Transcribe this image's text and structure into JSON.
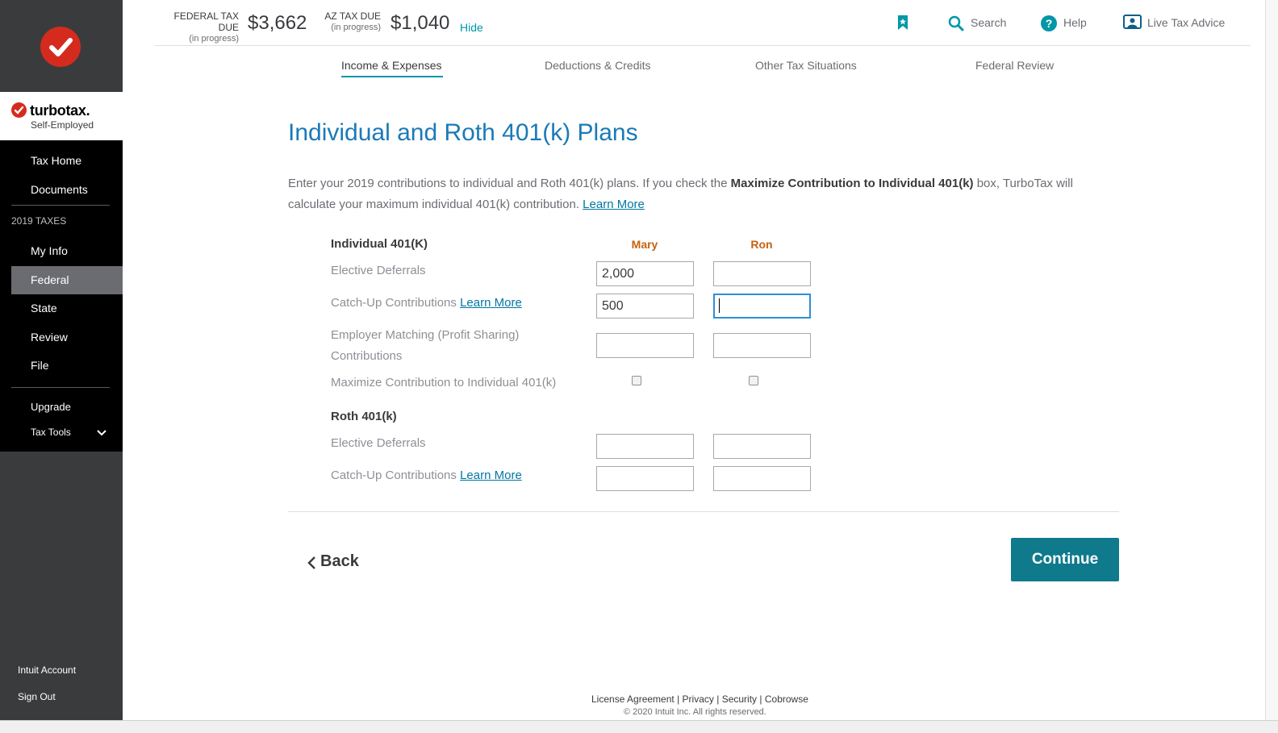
{
  "app": {
    "brand_name": "turbotax.",
    "brand_sub": "Self-Employed"
  },
  "sidebar": {
    "items": [
      {
        "label": "Tax Home"
      },
      {
        "label": "Documents"
      }
    ],
    "section_label": "2019 TAXES",
    "tax_items": [
      {
        "label": "My Info"
      },
      {
        "label": "Federal"
      },
      {
        "label": "State"
      },
      {
        "label": "Review"
      },
      {
        "label": "File"
      }
    ],
    "upgrade": "Upgrade",
    "tax_tools": "Tax Tools",
    "account": "Intuit Account",
    "sign_out": "Sign Out"
  },
  "header": {
    "federal_label": "FEDERAL TAX DUE",
    "federal_sub": "(in progress)",
    "federal_amount": "$3,662",
    "state_label": "AZ TAX DUE",
    "state_sub": "(in progress)",
    "state_amount": "$1,040",
    "hide": "Hide",
    "search": "Search",
    "help": "Help",
    "live_advice": "Live Tax Advice"
  },
  "tabs": [
    {
      "label": "Income & Expenses",
      "active": true
    },
    {
      "label": "Deductions & Credits"
    },
    {
      "label": "Other Tax Situations"
    },
    {
      "label": "Federal Review"
    }
  ],
  "main": {
    "title": "Individual and Roth 401(k) Plans",
    "intro_1": "Enter your 2019 contributions to individual and Roth 401(k) plans. If you check the ",
    "intro_bold": "Maximize Contribution to Individual 401(k)",
    "intro_2": " box, TurboTax will calculate your maximum individual 401(k) contribution. ",
    "learn_more": "Learn More",
    "columns": [
      "Mary",
      "Ron"
    ],
    "individual": {
      "heading": "Individual 401(K)",
      "elective_label": "Elective Deferrals",
      "catchup_label": "Catch-Up Contributions",
      "employer_label_1": "Employer Matching (Profit Sharing)",
      "employer_label_2": "Contributions",
      "maximize_label": "Maximize Contribution to Individual 401(k)",
      "mary_elective": "2,000",
      "mary_catchup": "500",
      "ron_elective": "",
      "ron_catchup": "",
      "mary_employer": "",
      "ron_employer": ""
    },
    "roth": {
      "heading": "Roth 401(k)",
      "elective_label": "Elective Deferrals",
      "catchup_label": "Catch-Up Contributions",
      "mary_elective": "",
      "ron_elective": "",
      "mary_catchup": "",
      "ron_catchup": ""
    },
    "back": "Back",
    "continue": "Continue"
  },
  "footer": {
    "license": "License Agreement",
    "privacy": "Privacy",
    "security": "Security",
    "cobrowse": "Cobrowse",
    "sep": "|",
    "copyright": "© 2020 Intuit Inc. All rights reserved."
  },
  "colors": {
    "accent": "#0097a7",
    "brand_red": "#d52b1e",
    "title_blue": "#1a7ab8",
    "column_orange": "#c6620f",
    "continue_bg": "#0e7a8c"
  }
}
